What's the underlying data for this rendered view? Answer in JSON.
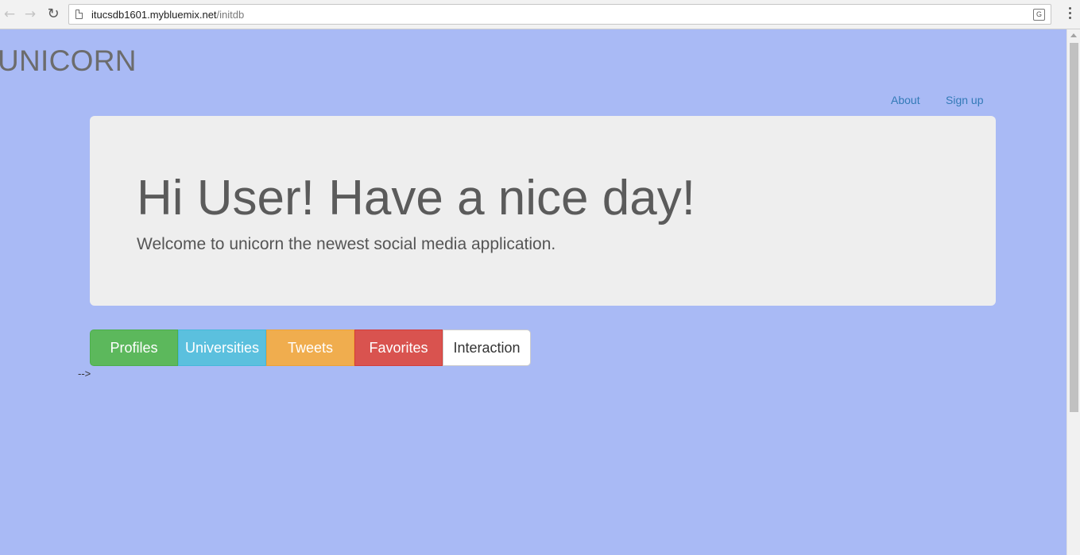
{
  "browser": {
    "url_host": "itucsdb1601.mybluemix.net",
    "url_path": "/initdb",
    "back_icon": "arrow-left-icon",
    "forward_icon": "arrow-right-icon",
    "reload_icon": "reload-icon",
    "translate_icon": "translate-icon",
    "menu_icon": "kebab-menu-icon"
  },
  "header": {
    "brand": "UNICORN",
    "nav": [
      {
        "label": "About"
      },
      {
        "label": "Sign up"
      }
    ]
  },
  "jumbotron": {
    "title": "Hi User! Have a nice day!",
    "text": "Welcome to unicorn the newest social media application."
  },
  "buttons": [
    {
      "label": "Profiles",
      "color": "#5cb85c"
    },
    {
      "label": "Universities",
      "color": "#5bc0de"
    },
    {
      "label": "Tweets",
      "color": "#f0ad4e"
    },
    {
      "label": "Favorites",
      "color": "#d9534f"
    },
    {
      "label": "Interaction",
      "color": "#ffffff"
    }
  ],
  "stray_text": "-->",
  "colors": {
    "page_background": "#a9baf5",
    "jumbotron_background": "#eeeeee",
    "link": "#337ab7"
  }
}
